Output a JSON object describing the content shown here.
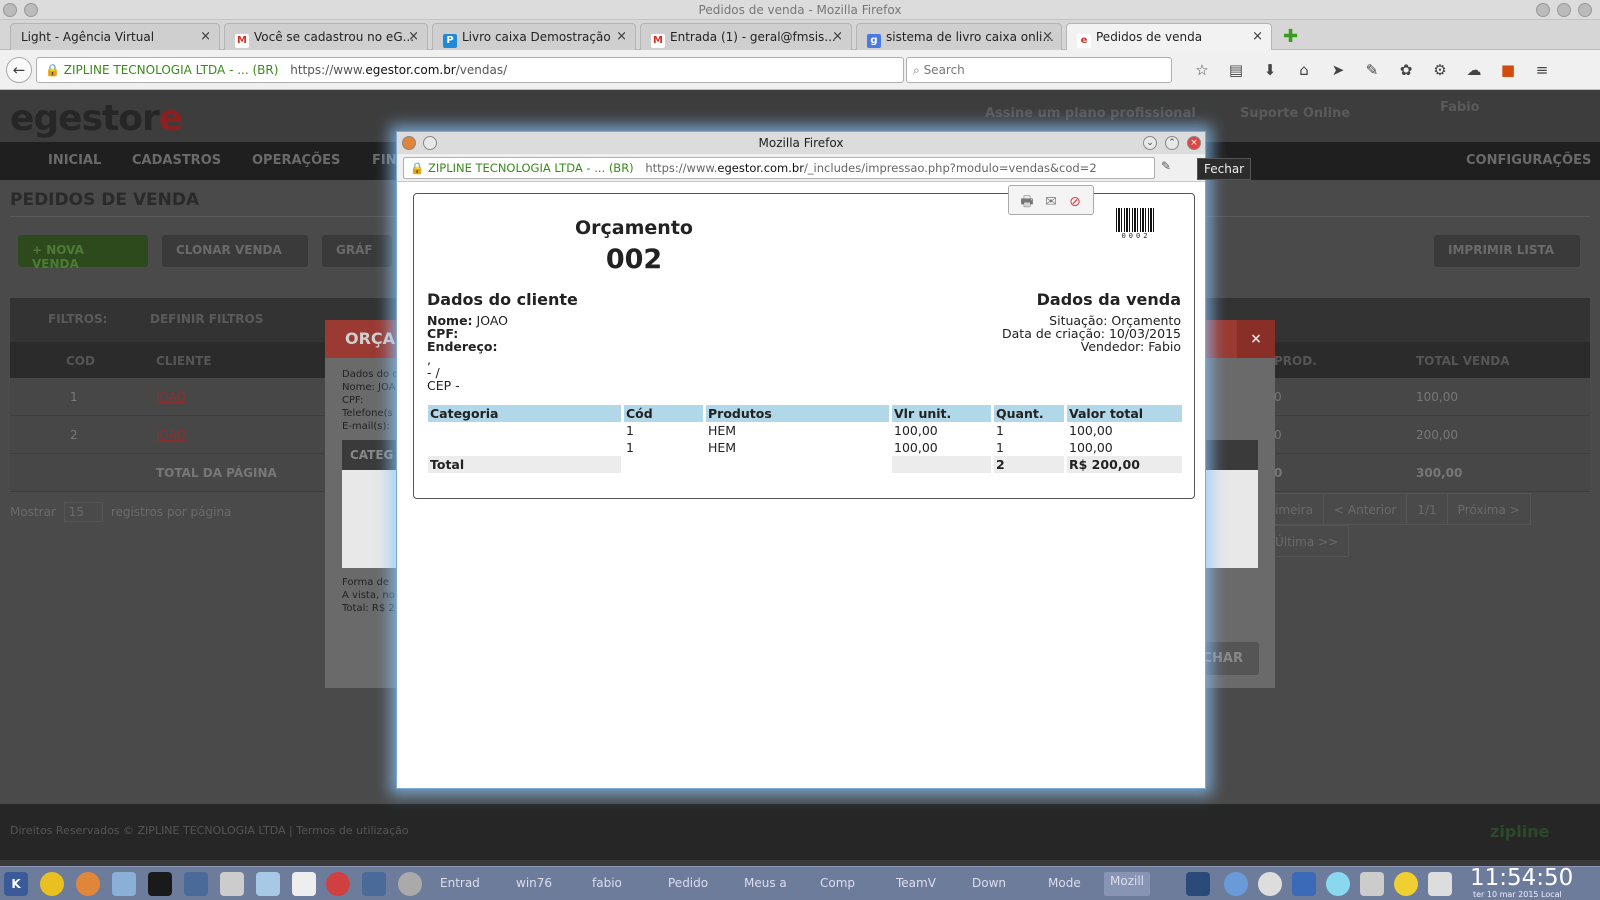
{
  "window": {
    "title": "Pedidos de venda - Mozilla Firefox"
  },
  "tabs": [
    {
      "label": "Light - Agência Virtual",
      "fav": "",
      "color": "#cfcfcf"
    },
    {
      "label": "Você se cadastrou no eG...",
      "fav": "M",
      "color": "#d93025"
    },
    {
      "label": "Livro caixa Demostração",
      "fav": "P",
      "color": "#1e8ad8"
    },
    {
      "label": "Entrada (1) - geral@fmsis...",
      "fav": "M",
      "color": "#d93025"
    },
    {
      "label": "sistema de livro caixa onli...",
      "fav": "g",
      "color": "#4a7ae0"
    },
    {
      "label": "Pedidos de venda",
      "fav": "e",
      "color": "#c0392b"
    }
  ],
  "navbar": {
    "org": "ZIPLINE TECNOLOGIA LTDA - ...",
    "country": "(BR)",
    "url_prefix": "https://www.",
    "url_domain": "egestor.com.br",
    "url_path": "/vendas/",
    "search_placeholder": "Search"
  },
  "page": {
    "logo_a": "egestor",
    "logo_b": "e",
    "plan": "Assine um plano profissional",
    "support": "Suporte Online",
    "user": "Fabio",
    "menu": [
      "INICIAL",
      "CADASTROS",
      "OPERAÇÕES",
      "FIN",
      "CONFIGURAÇÕES"
    ],
    "title": "PEDIDOS DE VENDA",
    "buttons": [
      "NOVA VENDA",
      "CLONAR VENDA",
      "GRÁF",
      "IMPRIMIR LISTA"
    ],
    "filters_label": "FILTROS:",
    "filters_button": "DEFINIR FILTROS",
    "columns": [
      "COD",
      "CLIENTE",
      "PROD.",
      "TOTAL VENDA"
    ],
    "rows": [
      {
        "cod": "1",
        "cliente": "JOAO",
        "prod": "0",
        "total": "100,00"
      },
      {
        "cod": "2",
        "cliente": "JOAO",
        "prod": "0",
        "total": "200,00"
      }
    ],
    "page_total_label": "TOTAL DA PÁGINA",
    "page_total_prod": "0",
    "page_total": "300,00",
    "show_label": "Mostrar",
    "per_page": "15",
    "per_page_label": "registros por página",
    "pager": [
      "imeira",
      "< Anterior",
      "1/1",
      "Próxima >",
      "Última >>"
    ],
    "footer": "Direitos Reservados © ZIPLINE TECNOLOGIA LTDA | Termos de utilização",
    "footer_brand": "zipline"
  },
  "red_modal": {
    "title": "ORÇAI",
    "close": "×",
    "info_lines": [
      "Dados do c",
      "Nome: JOA",
      "CPF:",
      "Telefone(s",
      "E-mail(s):"
    ],
    "categ": "CATEG",
    "pay_lines": [
      "Forma de",
      "A vista, no",
      "Total: R$ 2"
    ],
    "fechar": "CHAR"
  },
  "popup": {
    "title": "Mozilla Firefox",
    "org": "ZIPLINE TECNOLOGIA LTDA - ...",
    "country": "(BR)",
    "url_prefix": "https://www.",
    "url_domain": "egestor.com.br",
    "url_path": "/_includes/impressao.php?modulo=vendas&cod=2",
    "tooltip": "Fechar"
  },
  "document": {
    "title": "Orçamento",
    "number": "002",
    "barcode_number": "0002",
    "client_section": "Dados do cliente",
    "sale_section": "Dados da venda",
    "name_label": "Nome:",
    "name_value": "JOAO",
    "cpf_label": "CPF:",
    "address_label": "Endereço:",
    "address_line1": ",",
    "address_line2": "- /",
    "cep": "CEP -",
    "situation": "Situação: Orçamento",
    "created": "Data de criação: 10/03/2015",
    "seller": "Vendedor: Fabio",
    "table_headers": [
      "Categoria",
      "Cód",
      "Produtos",
      "Vlr unit.",
      "Quant.",
      "Valor total"
    ],
    "items": [
      {
        "categoria": "",
        "cod": "1",
        "produto": "HEM",
        "unit": "100,00",
        "quant": "1",
        "total": "100,00"
      },
      {
        "categoria": "",
        "cod": "1",
        "produto": "HEM",
        "unit": "100,00",
        "quant": "1",
        "total": "100,00"
      }
    ],
    "total_label": "Total",
    "total_quant": "2",
    "total_value": "R$ 200,00"
  },
  "taskbar": {
    "items": [
      "Entrad",
      "win76",
      "fabio",
      "Pedido",
      "Meus a",
      "Comp",
      "TeamV",
      "Down",
      "Mode",
      "Mozill"
    ],
    "clock": "11:54:50",
    "date": "ter 10 mar 2015 Local"
  }
}
